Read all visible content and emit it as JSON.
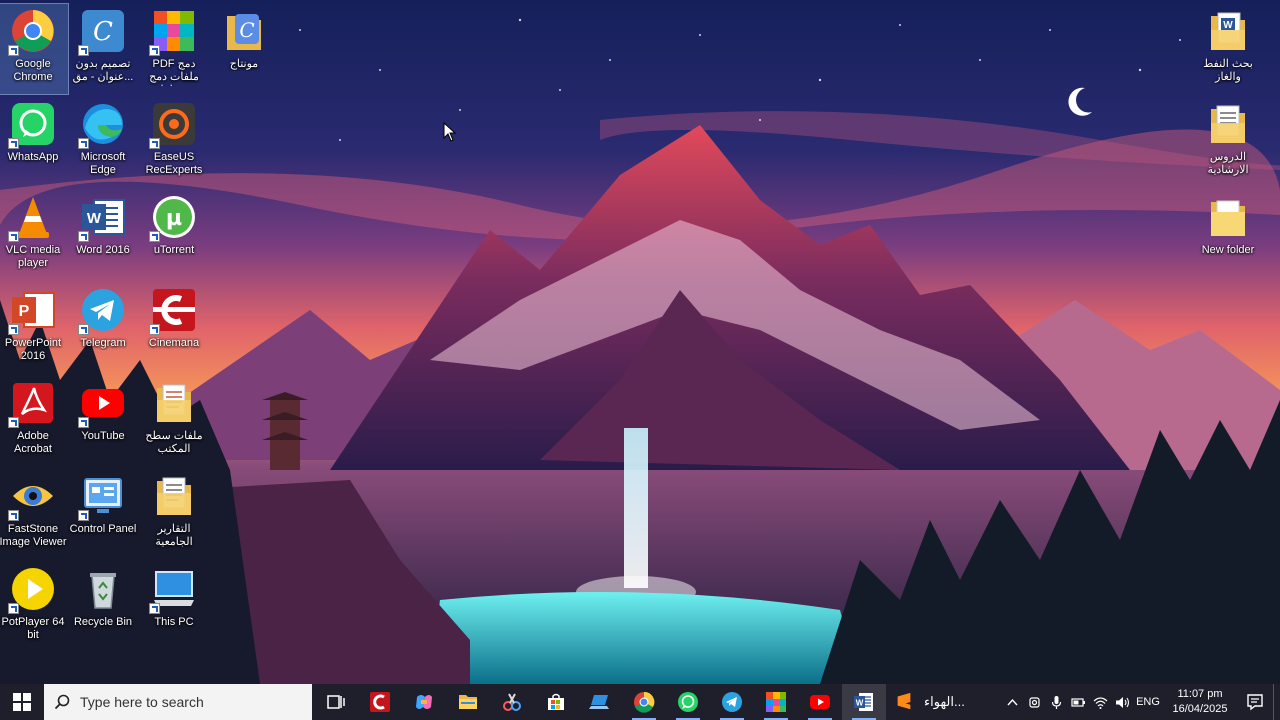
{
  "desktop": {
    "icons": [
      {
        "label": "Google Chrome",
        "icon": "chrome-icon",
        "selected": true
      },
      {
        "label": "تصميم بدون عنوان - مق...",
        "icon": "canva-icon"
      },
      {
        "label": "PDF دمج ملفات دمج ملفات - ...",
        "icon": "pdf-merge-icon"
      },
      {
        "label": "مونتاج",
        "icon": "canva-icon"
      },
      {
        "label": "WhatsApp",
        "icon": "whatsapp-icon"
      },
      {
        "label": "Microsoft Edge",
        "icon": "edge-icon"
      },
      {
        "label": "EaseUS RecExperts",
        "icon": "easeus-icon"
      },
      {
        "label": "VLC media player",
        "icon": "vlc-icon"
      },
      {
        "label": "Word 2016",
        "icon": "word-icon"
      },
      {
        "label": "uTorrent",
        "icon": "utorrent-icon"
      },
      {
        "label": "PowerPoint 2016",
        "icon": "powerpoint-icon"
      },
      {
        "label": "Telegram",
        "icon": "telegram-icon"
      },
      {
        "label": "Cinemana",
        "icon": "cinemana-icon"
      },
      {
        "label": "Adobe Acrobat",
        "icon": "acrobat-icon"
      },
      {
        "label": "YouTube",
        "icon": "youtube-icon"
      },
      {
        "label": "ملفات سطح المكتب",
        "icon": "folder-docs-icon"
      },
      {
        "label": "FastStone Image Viewer",
        "icon": "faststone-icon"
      },
      {
        "label": "Control Panel",
        "icon": "control-panel-icon"
      },
      {
        "label": "التقارير الجامعية",
        "icon": "folder-docs-icon"
      },
      {
        "label": "PotPlayer 64 bit",
        "icon": "potplayer-icon"
      },
      {
        "label": "Recycle Bin",
        "icon": "recycle-bin-icon"
      },
      {
        "label": "This PC",
        "icon": "this-pc-icon"
      },
      {
        "label": "بحث النفط والغاز",
        "icon": "word-folder-icon"
      },
      {
        "label": "الدروس الارشادية",
        "icon": "folder-docs-icon"
      },
      {
        "label": "New folder",
        "icon": "folder-icon"
      }
    ]
  },
  "taskbar": {
    "search_placeholder": "Type here to search",
    "apps": [
      {
        "name": "task-view",
        "icon": "task-view-icon"
      },
      {
        "name": "cinemana",
        "icon": "cinemana-icon"
      },
      {
        "name": "copilot",
        "icon": "copilot-icon"
      },
      {
        "name": "file-explorer",
        "icon": "folder-icon"
      },
      {
        "name": "snipping-tool",
        "icon": "snipping-icon"
      },
      {
        "name": "microsoft-store",
        "icon": "store-icon"
      },
      {
        "name": "pc-manager",
        "icon": "laptop-icon"
      },
      {
        "name": "chrome",
        "icon": "chrome-icon"
      },
      {
        "name": "whatsapp",
        "icon": "whatsapp-icon"
      },
      {
        "name": "telegram",
        "icon": "telegram-icon"
      },
      {
        "name": "pdf-merge",
        "icon": "pdf-merge-icon"
      },
      {
        "name": "youtube",
        "icon": "youtube-icon"
      },
      {
        "name": "word",
        "icon": "word-icon"
      }
    ],
    "open_window_label": "الهواء...",
    "lang": "ENG",
    "time": "11:07 pm",
    "date": "16/04/2025"
  }
}
